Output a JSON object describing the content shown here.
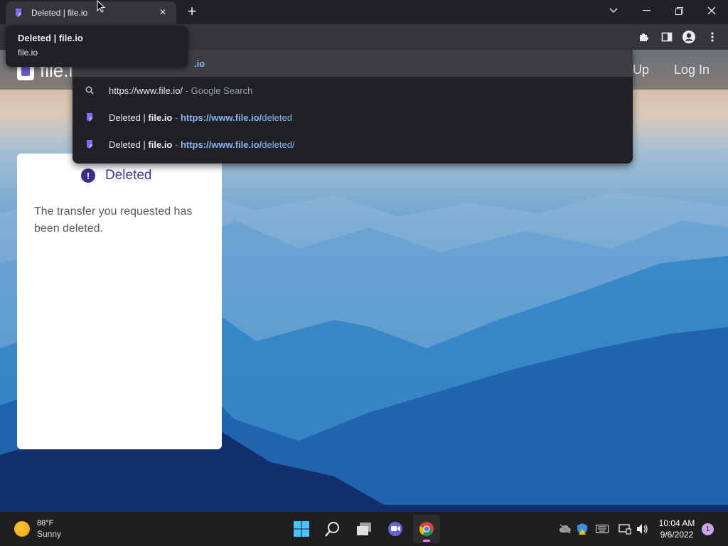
{
  "browser": {
    "tab": {
      "title": "Deleted | file.io",
      "close": "×"
    },
    "new_tab": "+",
    "window_controls": {
      "menu": "⌄",
      "minimize": "—",
      "restore": "❐",
      "close": "✕"
    },
    "omnibox_visible_text": "/",
    "tooltip": {
      "title": "Deleted | file.io",
      "subtitle": "file.io"
    }
  },
  "omnibox_dropdown": {
    "selected_text": ".io",
    "suggestions": [
      {
        "icon": "search-icon",
        "main": "https://www.file.io/",
        "sep": " - ",
        "hint": "Google Search"
      },
      {
        "icon": "fileio-favicon",
        "title_a": "Deleted | ",
        "title_b": "file.io",
        "sep": " - ",
        "url_a": "https://www.file.io/",
        "url_b": "deleted"
      },
      {
        "icon": "fileio-favicon",
        "title_a": "Deleted | ",
        "title_b": "file.io",
        "sep": " - ",
        "url_a": "https://www.file.io/",
        "url_b": "deleted/"
      }
    ]
  },
  "site": {
    "logo": "file.io",
    "nav": {
      "signup_partial": "Up",
      "login": "Log In"
    },
    "card": {
      "icon": "!",
      "title": "Deleted",
      "message": "The transfer you requested has been deleted."
    }
  },
  "taskbar": {
    "weather": {
      "temp": "88°F",
      "desc": "Sunny"
    },
    "clock": {
      "time": "10:04 AM",
      "date": "9/6/2022"
    },
    "notifications": "1"
  },
  "colors": {
    "accent": "#8ab4f8",
    "brand": "#3a2f8c",
    "chrome_dark": "#202124"
  }
}
